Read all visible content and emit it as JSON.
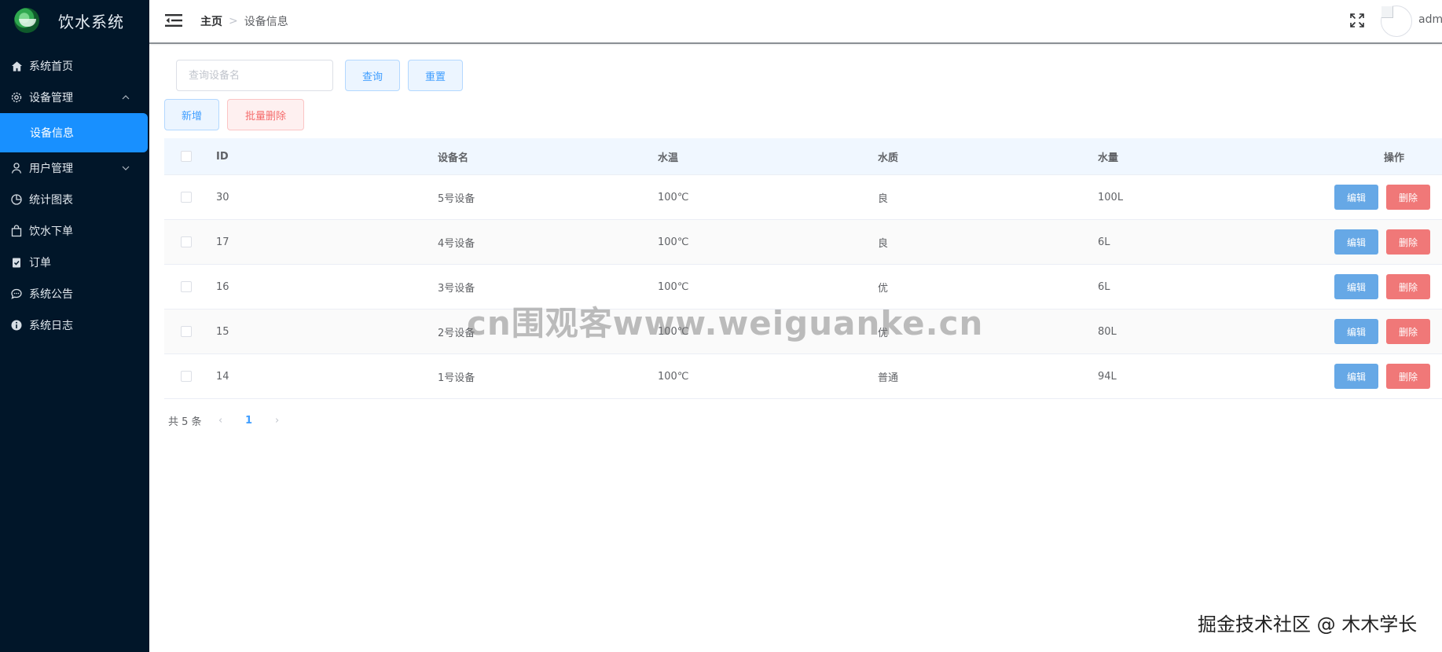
{
  "app": {
    "title": "饮水系统"
  },
  "sidebar": {
    "items": [
      {
        "label": "系统首页",
        "icon": "home-icon"
      },
      {
        "label": "设备管理",
        "icon": "gear-icon",
        "expanded": true,
        "children": [
          {
            "label": "设备信息",
            "active": true
          }
        ]
      },
      {
        "label": "用户管理",
        "icon": "user-icon",
        "expanded": false
      },
      {
        "label": "统计图表",
        "icon": "pie-chart-icon"
      },
      {
        "label": "饮水下单",
        "icon": "shopping-bag-icon"
      },
      {
        "label": "订单",
        "icon": "clipboard-check-icon"
      },
      {
        "label": "系统公告",
        "icon": "chat-bubble-icon"
      },
      {
        "label": "系统日志",
        "icon": "info-circle-icon"
      }
    ]
  },
  "header": {
    "breadcrumb": {
      "home": "主页",
      "separator": ">",
      "current": "设备信息"
    },
    "username": "adm"
  },
  "search": {
    "placeholder": "查询设备名",
    "value": ""
  },
  "toolbar": {
    "query_label": "查询",
    "reset_label": "重置",
    "add_label": "新增",
    "batch_delete_label": "批量删除"
  },
  "table": {
    "columns": [
      "ID",
      "设备名",
      "水温",
      "水质",
      "水量",
      "操作"
    ],
    "rows": [
      {
        "id": "30",
        "name": "5号设备",
        "temp": "100℃",
        "quality": "良",
        "amount": "100L"
      },
      {
        "id": "17",
        "name": "4号设备",
        "temp": "100℃",
        "quality": "良",
        "amount": "6L"
      },
      {
        "id": "16",
        "name": "3号设备",
        "temp": "100℃",
        "quality": "优",
        "amount": "6L"
      },
      {
        "id": "15",
        "name": "2号设备",
        "temp": "100℃",
        "quality": "优",
        "amount": "80L"
      },
      {
        "id": "14",
        "name": "1号设备",
        "temp": "100℃",
        "quality": "普通",
        "amount": "94L"
      }
    ],
    "edit_label": "编辑",
    "delete_label": "删除"
  },
  "pagination": {
    "total_text": "共 5 条",
    "current_page": "1"
  },
  "watermark": "cn围观客www.weiguanke.cn",
  "footer_mark": "掘金技术社区 @ 木木学长",
  "colors": {
    "sidebar_bg": "#011629",
    "active_item": "#1890ff",
    "primary": "#409eff",
    "danger": "#f56c6c",
    "edit_button": "#66a8e6",
    "delete_button": "#f07878"
  }
}
